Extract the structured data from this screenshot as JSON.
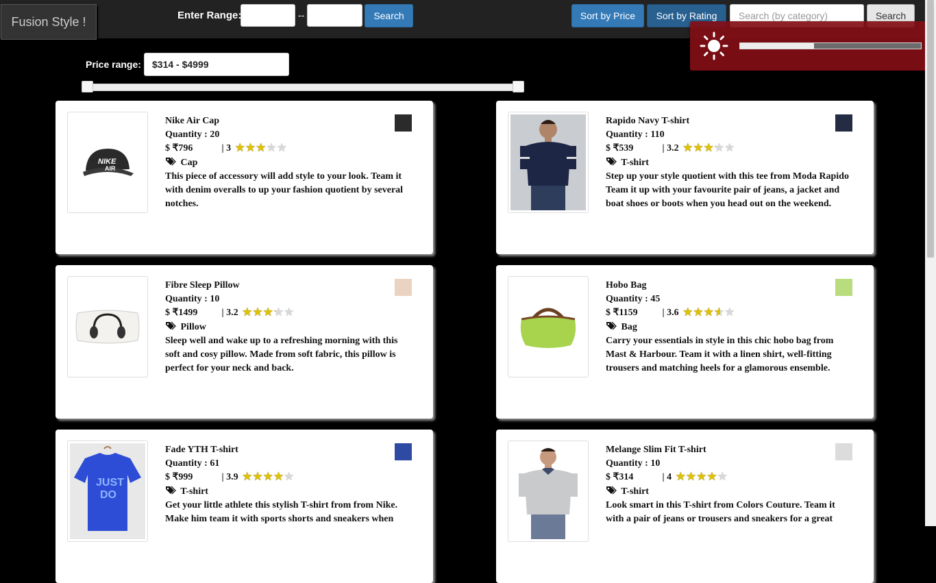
{
  "brand": "Fusion Style !",
  "range": {
    "label": "Enter Range:",
    "min_value": "",
    "max_value": "",
    "separator": "--",
    "search_label": "Search"
  },
  "toolbar": {
    "sort_price": "Sort by Price",
    "sort_rating": "Sort by Rating",
    "category_placeholder": "Search (by category)",
    "search_label": "Search"
  },
  "brightness": {
    "icon": "sun-icon",
    "level": 0.41
  },
  "price_filter": {
    "label": "Price range:",
    "value": "$314 - $4999",
    "min": 314,
    "max": 4999,
    "low": 314,
    "high": 4999
  },
  "products": [
    {
      "name": "Nike Air Cap",
      "quantity": "Quantity : 20",
      "price": "$ ₹796",
      "rating": 3,
      "rating_text": "| 3",
      "category": "Cap",
      "description": "This piece of accessory will add style to your look. Team it with denim overalls to up your fashion quotient by several notches.",
      "color": "#2b2b2b"
    },
    {
      "name": "Rapido Navy T-shirt",
      "quantity": "Quantity : 110",
      "price": "$ ₹539",
      "rating": 3.2,
      "rating_text": "| 3.2",
      "category": "T-shirt",
      "description": "Step up your style quotient with this tee from Moda Rapido Team it up with your favourite pair of jeans, a jacket and boat shoes or boots when you head out on the weekend.",
      "color": "#242c44"
    },
    {
      "name": "Fibre Sleep Pillow",
      "quantity": "Quantity : 10",
      "price": "$ ₹1499",
      "rating": 3.2,
      "rating_text": "| 3.2",
      "category": "Pillow",
      "description": "Sleep well and wake up to a refreshing morning with this soft and cosy pillow. Made from soft fabric, this pillow is perfect for your neck and back.",
      "color": "#ead4c1"
    },
    {
      "name": "Hobo Bag",
      "quantity": "Quantity : 45",
      "price": "$ ₹1159",
      "rating": 3.6,
      "rating_text": "| 3.6",
      "category": "Bag",
      "description": "Carry your essentials in style in this chic hobo bag from Mast & Harbour. Team it with a linen shirt, well-fitting trousers and matching heels for a glamorous ensemble.",
      "color": "#b9dc7f"
    },
    {
      "name": "Fade YTH T-shirt",
      "quantity": "Quantity : 61",
      "price": "$ ₹999",
      "rating": 3.9,
      "rating_text": "| 3.9",
      "category": "T-shirt",
      "description": "Get your little athlete this stylish T-shirt from from Nike. Make him team it with sports shorts and sneakers when",
      "color": "#2f4aa3"
    },
    {
      "name": "Melange Slim Fit T-shirt",
      "quantity": "Quantity : 10",
      "price": "$ ₹314",
      "rating": 4,
      "rating_text": "| 4",
      "category": "T-shirt",
      "description": "Look smart in this T-shirt from Colors Couture. Team it with a pair of jeans or trousers and sneakers for a great",
      "color": "#dcdcdc"
    }
  ]
}
